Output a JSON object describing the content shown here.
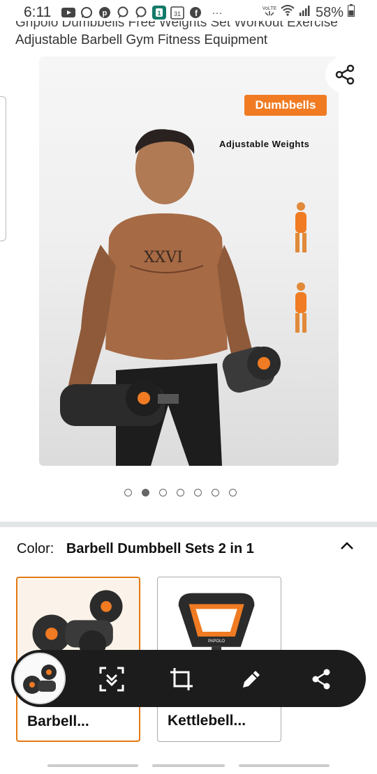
{
  "status_bar": {
    "time": "6:11",
    "battery": "58%",
    "notification_icons": [
      "youtube-icon",
      "whatsapp-icon",
      "pinterest-icon",
      "chat-bubble-icon",
      "chat-bubble-icon",
      "app-badge-icon",
      "calendar-icon",
      "facebook-icon",
      "more-dots-icon"
    ],
    "calendar_day": "31",
    "more": "···",
    "right_icons": [
      "volte-icon",
      "wifi-icon",
      "signal-icon",
      "battery-icon"
    ]
  },
  "product": {
    "title_line1": "Gnpolo Dumbbells Free Weights Set Workout Exercise",
    "title_line2": "Adjustable Barbell Gym Fitness Equipment",
    "image": {
      "badge": "Dumbbells",
      "subtitle": "Adjustable Weights",
      "tattoo": "XXVI"
    },
    "carousel": {
      "count": 7,
      "active_index": 1
    }
  },
  "color_selector": {
    "label": "Color:",
    "value": "Barbell Dumbbell Sets 2 in 1",
    "options": [
      {
        "label": "Barbell...",
        "selected": true
      },
      {
        "label": "Kettlebell...",
        "selected": false
      }
    ],
    "kettlebell_brand": "PAPOLO"
  },
  "screenshot_toolbar": {
    "buttons": [
      "scroll-capture-icon",
      "crop-icon",
      "edit-pen-icon",
      "share-icon"
    ]
  },
  "colors": {
    "accent_orange": "#f07b22",
    "selected_border": "#e47911",
    "toolbar_bg": "#1c1c1c"
  }
}
